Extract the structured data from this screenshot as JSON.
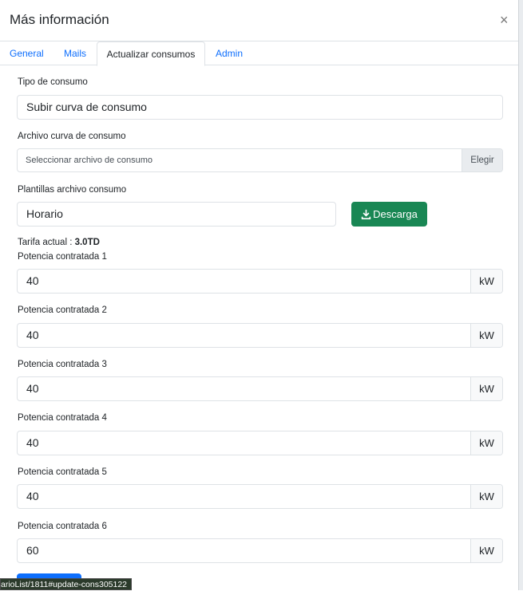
{
  "modal": {
    "title": "Más información",
    "close_label": "×"
  },
  "tabs": [
    {
      "label": "General",
      "active": false
    },
    {
      "label": "Mails",
      "active": false
    },
    {
      "label": "Actualizar consumos",
      "active": true
    },
    {
      "label": "Admin",
      "active": false
    }
  ],
  "form": {
    "tipo_consumo": {
      "label": "Tipo de consumo",
      "value": "Subir curva de consumo"
    },
    "archivo_curva": {
      "label": "Archivo curva de consumo",
      "placeholder": "Seleccionar archivo de consumo",
      "button": "Elegir"
    },
    "plantillas": {
      "label": "Plantillas archivo consumo",
      "value": "Horario",
      "button": "Descarga"
    },
    "tarifa": {
      "label": "Tarifa actual : ",
      "value": "3.0TD"
    },
    "potencias": [
      {
        "label": "Potencia contratada 1",
        "value": "40",
        "unit": "kW"
      },
      {
        "label": "Potencia contratada 2",
        "value": "40",
        "unit": "kW"
      },
      {
        "label": "Potencia contratada 3",
        "value": "40",
        "unit": "kW"
      },
      {
        "label": "Potencia contratada 4",
        "value": "40",
        "unit": "kW"
      },
      {
        "label": "Potencia contratada 5",
        "value": "40",
        "unit": "kW"
      },
      {
        "label": "Potencia contratada 6",
        "value": "60",
        "unit": "kW"
      }
    ]
  },
  "status_bar": {
    "url": "arioList/1811#update-cons305122"
  },
  "colors": {
    "accent": "#0d6efd",
    "download": "#198754"
  }
}
